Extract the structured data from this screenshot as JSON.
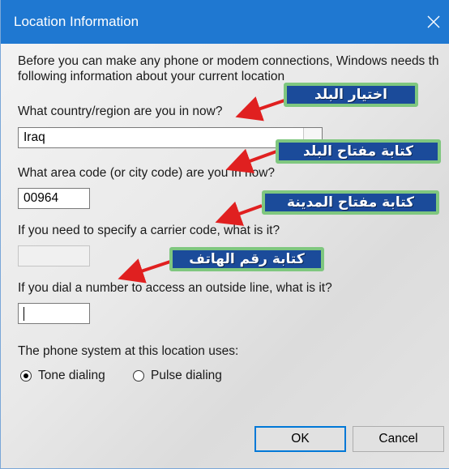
{
  "window": {
    "title": "Location Information",
    "close_icon": "close-icon"
  },
  "intro": {
    "line1": "Before you can make any phone or modem connections, Windows needs th",
    "line2": "following information about your current location"
  },
  "country": {
    "label": "What country/region are you in now?",
    "value": "Iraq"
  },
  "area_code": {
    "label": "What area code (or city code) are you in now?",
    "value": "00964"
  },
  "carrier_code": {
    "label": "If you need to specify a carrier code, what is it?",
    "value": ""
  },
  "outside_line": {
    "label": "If you dial a number to access an outside line, what is it?",
    "value": ""
  },
  "phone_system": {
    "label": "The phone system at this location uses:",
    "options": [
      {
        "label": "Tone dialing",
        "selected": true
      },
      {
        "label": "Pulse dialing",
        "selected": false
      }
    ]
  },
  "buttons": {
    "ok": "OK",
    "cancel": "Cancel"
  },
  "annotations": {
    "a1": "اختيار البلد",
    "a2": "كتابة مفتاح البلد",
    "a3": "كتابة مفتاح المدينة",
    "a4": "كتابة رقم الهاتف"
  },
  "colors": {
    "titlebar": "#1f78d1",
    "arrow": "#e02020",
    "annotation_bg": "#1b4b9a",
    "annotation_border": "#7fc77f"
  }
}
